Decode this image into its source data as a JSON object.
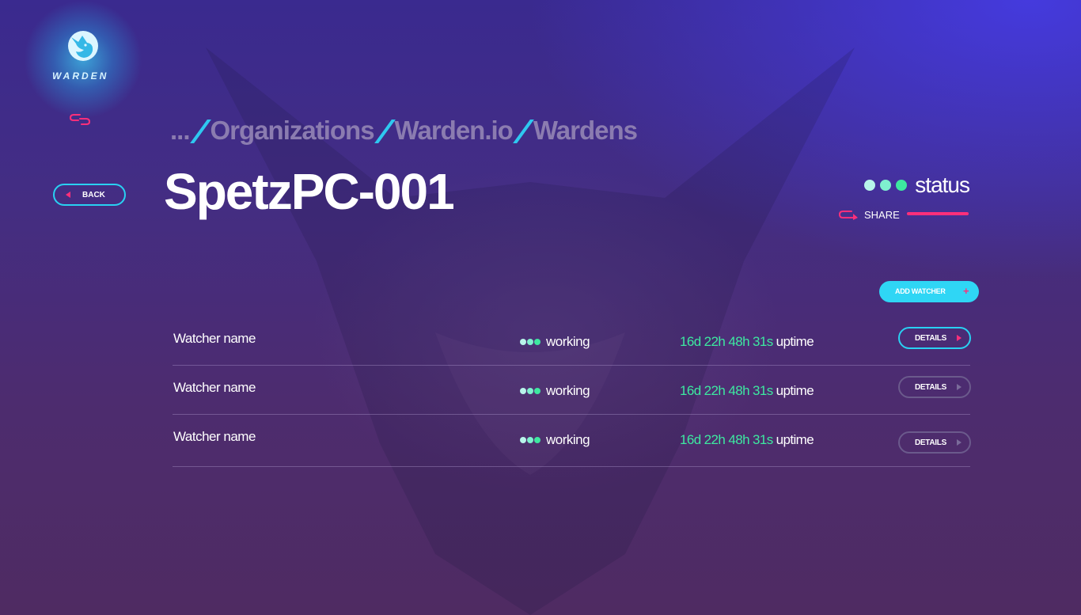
{
  "brand": {
    "name": "WARDEN",
    "icon": "fox-logo-icon",
    "accent_color": "#2fd6f5",
    "highlight_color": "#ff2f7a",
    "success_color": "#3de8a0"
  },
  "nav": {
    "link_icon": "link-icon",
    "back_label": "BACK"
  },
  "breadcrumb": {
    "items": [
      "...",
      "Organizations",
      "Warden.io",
      "Wardens"
    ]
  },
  "page": {
    "title": "SpetzPC-001"
  },
  "status": {
    "label": "status",
    "dot_colors": [
      "#b8f5ea",
      "#7ff0cf",
      "#3de8a0"
    ]
  },
  "share": {
    "label": "SHARE",
    "icon": "share-arrow-icon"
  },
  "actions": {
    "add_watcher_label": "ADD WATCHER",
    "add_icon": "+"
  },
  "watchers": [
    {
      "name": "Watcher name",
      "status": "working",
      "uptime": "16d 22h 48h 31s",
      "uptime_suffix": "uptime",
      "details_label": "DETAILS"
    },
    {
      "name": "Watcher name",
      "status": "working",
      "uptime": "16d 22h 48h 31s",
      "uptime_suffix": "uptime",
      "details_label": "DETAILS"
    },
    {
      "name": "Watcher name",
      "status": "working",
      "uptime": "16d 22h 48h 31s",
      "uptime_suffix": "uptime",
      "details_label": "DETAILS"
    }
  ]
}
